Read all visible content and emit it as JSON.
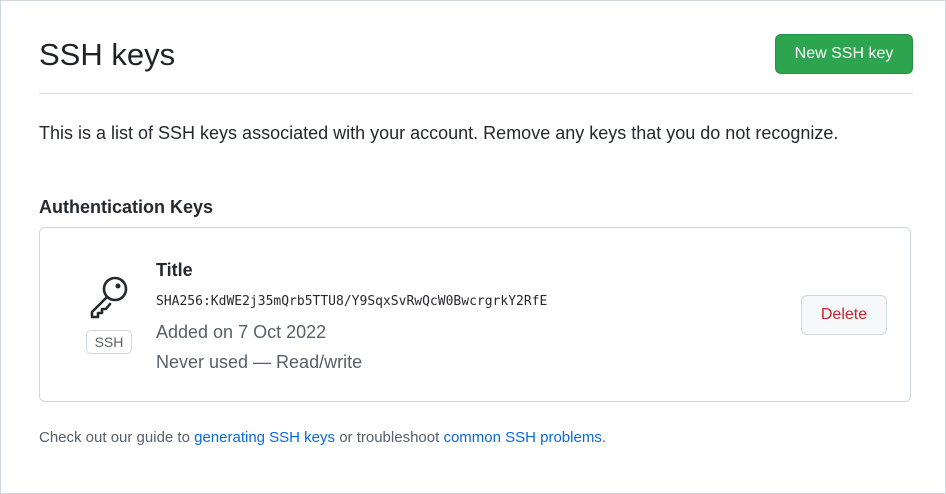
{
  "header": {
    "title": "SSH keys",
    "new_button_label": "New SSH key"
  },
  "intro": {
    "text": "This is a list of SSH keys associated with your account. Remove any keys that you do not recognize."
  },
  "auth_keys": {
    "section_title": "Authentication Keys",
    "keys": [
      {
        "icon": "key-icon",
        "type_label": "SSH",
        "title": "Title",
        "fingerprint": "SHA256:KdWE2j35mQrb5TTU8/Y9SqxSvRwQcW0BwcrgrkY2RfE",
        "added": "Added on 7 Oct 2022",
        "usage": "Never used — Read/write",
        "delete_label": "Delete"
      }
    ]
  },
  "footer": {
    "text_before": "Check out our guide to ",
    "link1": "generating SSH keys",
    "text_middle": " or troubleshoot ",
    "link2": "common SSH problems",
    "text_after": "."
  },
  "colors": {
    "primary_button": "#2da44e",
    "danger": "#cf222e",
    "link": "#0969da",
    "border": "#d0d7de"
  }
}
